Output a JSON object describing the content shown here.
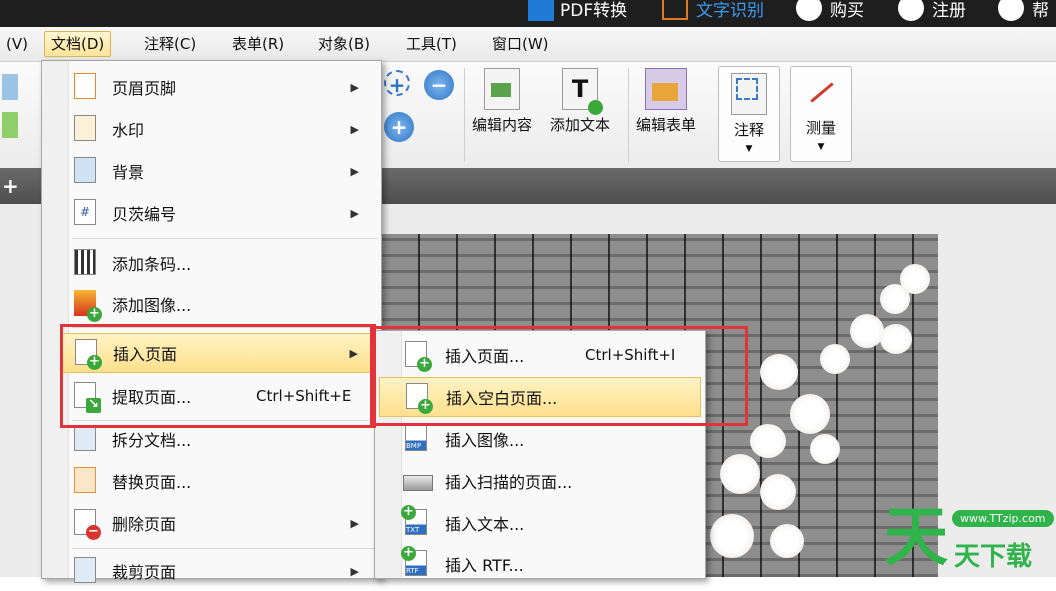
{
  "titlebar": {
    "pdf_convert": "PDF转换",
    "ocr": "文字识别",
    "buy": "购买",
    "register": "注册",
    "help": "帮"
  },
  "menubar": {
    "view": "(V)",
    "document": "文档(D)",
    "annotate": "注释(C)",
    "forms": "表单(R)",
    "object": "对象(B)",
    "tools": "工具(T)",
    "window": "窗口(W)"
  },
  "toolbar": {
    "edit_content": "编辑内容",
    "add_text": "添加文本",
    "edit_form": "编辑表单",
    "annotate": "注释",
    "measure": "测量"
  },
  "document_menu": {
    "items": [
      {
        "label": "页眉页脚",
        "submenu": true
      },
      {
        "label": "水印",
        "submenu": true
      },
      {
        "label": "背景",
        "submenu": true
      },
      {
        "label": "贝茨编号",
        "submenu": true
      },
      {
        "label": "添加条码..."
      },
      {
        "label": "添加图像..."
      },
      {
        "label": "插入页面",
        "submenu": true
      },
      {
        "label": "提取页面...",
        "shortcut": "Ctrl+Shift+E"
      },
      {
        "label": "拆分文档..."
      },
      {
        "label": "替换页面..."
      },
      {
        "label": "删除页面",
        "submenu": true
      },
      {
        "label": "裁剪页面",
        "submenu": true
      }
    ]
  },
  "insert_submenu": {
    "items": [
      {
        "label": "插入页面...",
        "shortcut": "Ctrl+Shift+I"
      },
      {
        "label": "插入空白页面..."
      },
      {
        "label": "插入图像..."
      },
      {
        "label": "插入扫描的页面..."
      },
      {
        "label": "插入文本..."
      },
      {
        "label": "插入 RTF..."
      }
    ]
  },
  "icon_tags": {
    "bmp": "BMP",
    "txt": "TXT",
    "rtf": "RTF",
    "hash": "#"
  },
  "watermark": {
    "url": "www.TTzip.com",
    "brand": "天下载"
  },
  "colors": {
    "highlight": "#fde08c",
    "annotation_red": "#e0333a",
    "brand_green": "#2fb34a"
  }
}
